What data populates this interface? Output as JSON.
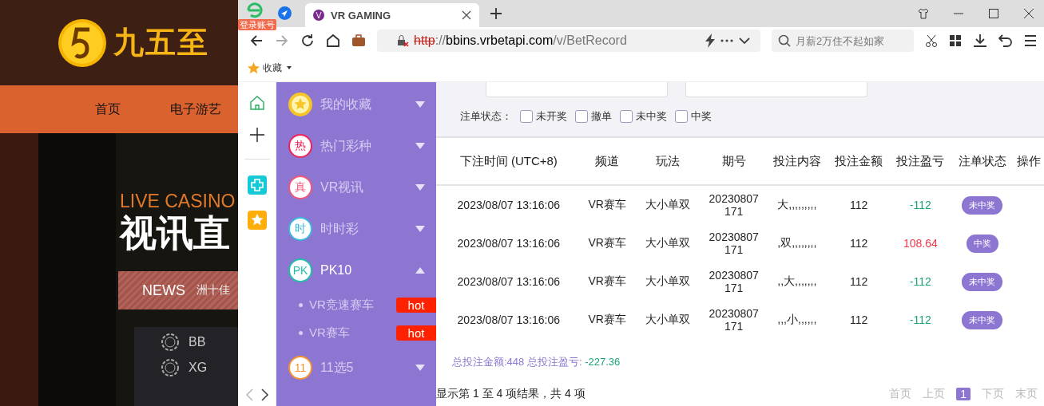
{
  "background_site": {
    "logo_text": "九五至",
    "nav": [
      "首页",
      "电子游艺"
    ],
    "hero_kicker": "LIVE CASINO",
    "hero_title": "视讯直",
    "news_label": "NEWS",
    "news_ticker": "洲十佳",
    "providers": [
      "BB",
      "XG"
    ]
  },
  "browser": {
    "login_badge": "登录账号",
    "tab_title": "VR GAMING",
    "url_scheme": "http",
    "url_sep": "://",
    "url_host": "bbins.vrbetapi.com",
    "url_path": "/v/BetRecord",
    "search_placeholder": "月薪2万住不起如家",
    "bookmark": "收藏"
  },
  "sidebar": {
    "items": [
      {
        "kind": "star",
        "label": "我的收藏",
        "expanded": false,
        "color": "#f7c528"
      },
      {
        "kind": "glyph",
        "glyph": "热",
        "label": "热门彩种",
        "expanded": false,
        "color": "#f0235a"
      },
      {
        "kind": "glyph",
        "glyph": "真",
        "label": "VR视讯",
        "expanded": false,
        "color": "#f2587a"
      },
      {
        "kind": "glyph",
        "glyph": "时",
        "label": "时时彩",
        "expanded": false,
        "color": "#3cb8d8"
      },
      {
        "kind": "glyph",
        "glyph": "PK",
        "label": "PK10",
        "expanded": true,
        "color": "#23bfa6",
        "children": [
          {
            "label": "VR竞速赛车",
            "badge": "hot"
          },
          {
            "label": "VR赛车",
            "badge": "hot"
          }
        ]
      },
      {
        "kind": "glyph",
        "glyph": "11",
        "label": "11选5",
        "expanded": false,
        "color": "#f5932e"
      }
    ]
  },
  "filter": {
    "status_label": "注单状态：",
    "options": [
      {
        "label": "未开奖",
        "checked": false
      },
      {
        "label": "撤单",
        "checked": false
      },
      {
        "label": "未中奖",
        "checked": false
      },
      {
        "label": "中奖",
        "checked": false
      }
    ]
  },
  "table": {
    "columns": [
      "下注时间 (UTC+8)",
      "频道",
      "玩法",
      "期号",
      "投注内容",
      "投注金额",
      "投注盈亏",
      "注单状态",
      "操作"
    ],
    "rows": [
      {
        "time": "2023/08/07 13:16:06",
        "channel": "VR赛车",
        "play": "大小单双",
        "period": "20230807171",
        "content": "大,,,,,,,,,",
        "amount": "112",
        "profit": "-112",
        "status": "未中奖",
        "won": false
      },
      {
        "time": "2023/08/07 13:16:06",
        "channel": "VR赛车",
        "play": "大小单双",
        "period": "20230807171",
        "content": ",双,,,,,,,,",
        "amount": "112",
        "profit": "108.64",
        "status": "中奖",
        "won": true
      },
      {
        "time": "2023/08/07 13:16:06",
        "channel": "VR赛车",
        "play": "大小单双",
        "period": "20230807171",
        "content": ",,大,,,,,,,",
        "amount": "112",
        "profit": "-112",
        "status": "未中奖",
        "won": false
      },
      {
        "time": "2023/08/07 13:16:06",
        "channel": "VR赛车",
        "play": "大小单双",
        "period": "20230807171",
        "content": ",,,小,,,,,,",
        "amount": "112",
        "profit": "-112",
        "status": "未中奖",
        "won": false
      }
    ]
  },
  "summary": {
    "label": "总投注金额:448 总投注盈亏:",
    "value": "-227.36"
  },
  "footer": {
    "info": "显示第 1 至 4 项结果，共 4 项",
    "pages": [
      {
        "label": "首页",
        "selected": false
      },
      {
        "label": "上页",
        "selected": false
      },
      {
        "label": "1",
        "selected": true
      },
      {
        "label": "下页",
        "selected": false
      },
      {
        "label": "末页",
        "selected": false
      }
    ]
  }
}
